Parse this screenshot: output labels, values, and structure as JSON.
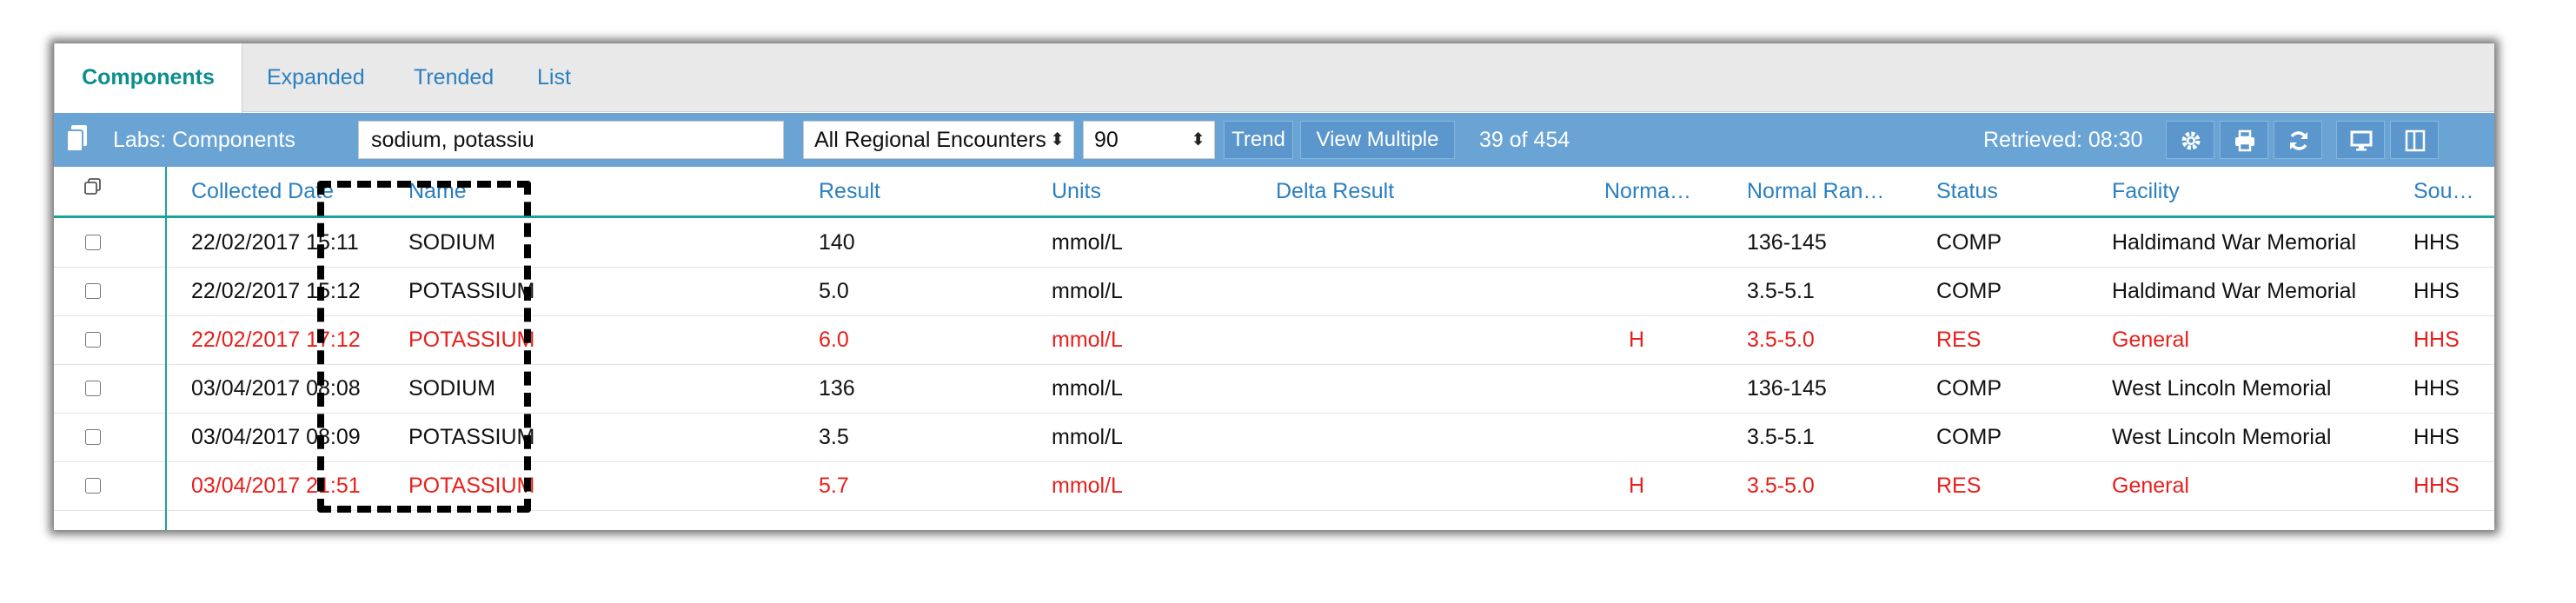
{
  "tabs": [
    {
      "label": "Components"
    },
    {
      "label": "Expanded"
    },
    {
      "label": "Trended"
    },
    {
      "label": "List"
    }
  ],
  "toolbar": {
    "title": "Labs: Components",
    "search_value": "sodium, potassiu",
    "encounter_select": "All Regional Encounters",
    "days_select": "90",
    "trend_label": "Trend",
    "view_multiple_label": "View Multiple",
    "count": "39 of 454",
    "retrieved": "Retrieved: 08:30"
  },
  "columns": [
    "Collected Date",
    "Name",
    "Result",
    "Units",
    "Delta Result",
    "Norma…",
    "Normal Ran…",
    "Status",
    "Facility",
    "Sou…"
  ],
  "rows": [
    {
      "date": "22/02/2017 15:11",
      "name": "SODIUM",
      "result": "140",
      "units": "mmol/L",
      "delta": "",
      "flag": "",
      "range": "136-145",
      "status": "COMP",
      "facility": "Haldimand War Memorial",
      "source": "HHS",
      "abnormal": false
    },
    {
      "date": "22/02/2017 15:12",
      "name": "POTASSIUM",
      "result": "5.0",
      "units": "mmol/L",
      "delta": "",
      "flag": "",
      "range": "3.5-5.1",
      "status": "COMP",
      "facility": "Haldimand War Memorial",
      "source": "HHS",
      "abnormal": false
    },
    {
      "date": "22/02/2017 17:12",
      "name": "POTASSIUM",
      "result": "6.0",
      "units": "mmol/L",
      "delta": "",
      "flag": "H",
      "range": "3.5-5.0",
      "status": "RES",
      "facility": "General",
      "source": "HHS",
      "abnormal": true
    },
    {
      "date": "03/04/2017 08:08",
      "name": "SODIUM",
      "result": "136",
      "units": "mmol/L",
      "delta": "",
      "flag": "",
      "range": "136-145",
      "status": "COMP",
      "facility": "West Lincoln Memorial",
      "source": "HHS",
      "abnormal": false
    },
    {
      "date": "03/04/2017 08:09",
      "name": "POTASSIUM",
      "result": "3.5",
      "units": "mmol/L",
      "delta": "",
      "flag": "",
      "range": "3.5-5.1",
      "status": "COMP",
      "facility": "West Lincoln Memorial",
      "source": "HHS",
      "abnormal": false
    },
    {
      "date": "03/04/2017 21:51",
      "name": "POTASSIUM",
      "result": "5.7",
      "units": "mmol/L",
      "delta": "",
      "flag": "H",
      "range": "3.5-5.0",
      "status": "RES",
      "facility": "General",
      "source": "HHS",
      "abnormal": true
    }
  ],
  "icons": [
    "document-icon",
    "gear-icon",
    "print-icon",
    "refresh-icon",
    "monitor-icon",
    "panel-icon",
    "copy-icon",
    "checkbox-icon"
  ],
  "colors": {
    "accent": "#1aa39a",
    "toolbar": "#6aa4d5",
    "link": "#2a7fc0",
    "abnormal": "#e8201c"
  }
}
